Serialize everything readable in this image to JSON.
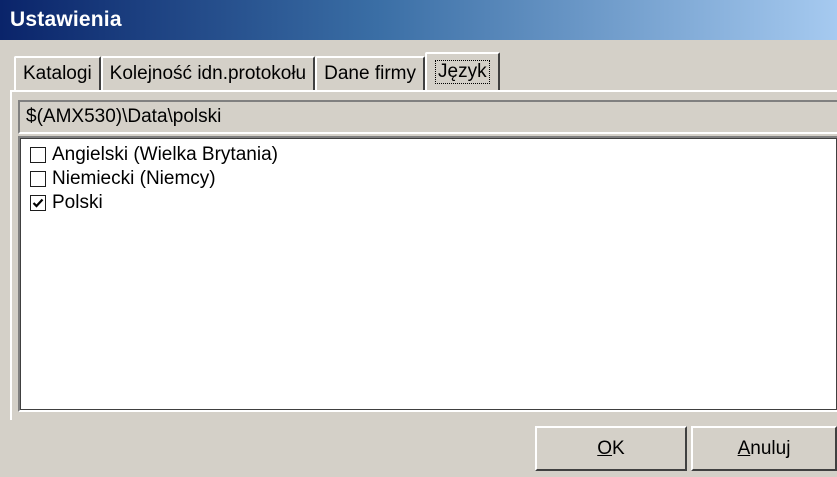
{
  "window": {
    "title": "Ustawienia"
  },
  "tabs": [
    {
      "label": "Katalogi",
      "active": false
    },
    {
      "label": "Kolejność idn.protokołu",
      "active": false
    },
    {
      "label": "Dane firmy",
      "active": false
    },
    {
      "label": "Język",
      "active": true
    }
  ],
  "path": "$(AMX530)\\Data\\polski",
  "languages": [
    {
      "label": "Angielski (Wielka Brytania)",
      "checked": false
    },
    {
      "label": "Niemiecki (Niemcy)",
      "checked": false
    },
    {
      "label": "Polski",
      "checked": true
    }
  ],
  "buttons": {
    "ok": {
      "mnemonic": "O",
      "rest": "K"
    },
    "cancel": {
      "mnemonic": "A",
      "rest": "nuluj"
    }
  },
  "colors": {
    "title_start": "#0a246a",
    "title_end": "#a6caf0",
    "face": "#d4d0c8"
  }
}
